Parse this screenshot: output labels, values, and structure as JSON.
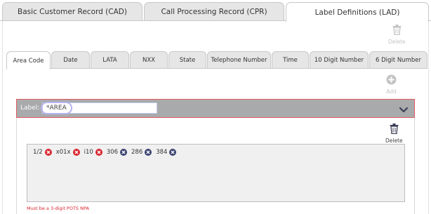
{
  "top_tabs": [
    {
      "label": "Basic Customer Record (CAD)",
      "active": false
    },
    {
      "label": "Call Processing Record (CPR)",
      "active": false
    },
    {
      "label": "Label Definitions (LAD)",
      "active": true
    }
  ],
  "toolbar": {
    "delete_label": "Delete",
    "add_label": "Add"
  },
  "sub_tabs": [
    {
      "label": "Area Code",
      "active": true
    },
    {
      "label": "Date",
      "active": false
    },
    {
      "label": "LATA",
      "active": false
    },
    {
      "label": "NXX",
      "active": false
    },
    {
      "label": "State",
      "active": false
    },
    {
      "label": "Telephone Number",
      "active": false
    },
    {
      "label": "Time",
      "active": false
    },
    {
      "label": "10 Digit Number",
      "active": false
    },
    {
      "label": "6 Digit Number",
      "active": false
    }
  ],
  "label_section": {
    "label_text": "Label:",
    "label_value": "*AREA"
  },
  "values_section": {
    "delete_label": "Delete"
  },
  "values": [
    {
      "text": "1/2",
      "status": "error"
    },
    {
      "text": "x01x",
      "status": "error"
    },
    {
      "text": "i10",
      "status": "error"
    },
    {
      "text": "306",
      "status": "valid"
    },
    {
      "text": "286",
      "status": "valid"
    },
    {
      "text": "384",
      "status": "valid"
    }
  ],
  "error_message": "Must be a 3-digit POTS NPA",
  "colors": {
    "error": "#d9252e",
    "valid": "#3a4371",
    "highlight_border": "#e35a62",
    "header_bg": "#a9aaab"
  },
  "icons": [
    "trash-icon",
    "plus-circle-icon",
    "chevron-down-icon",
    "remove-chip-icon"
  ]
}
